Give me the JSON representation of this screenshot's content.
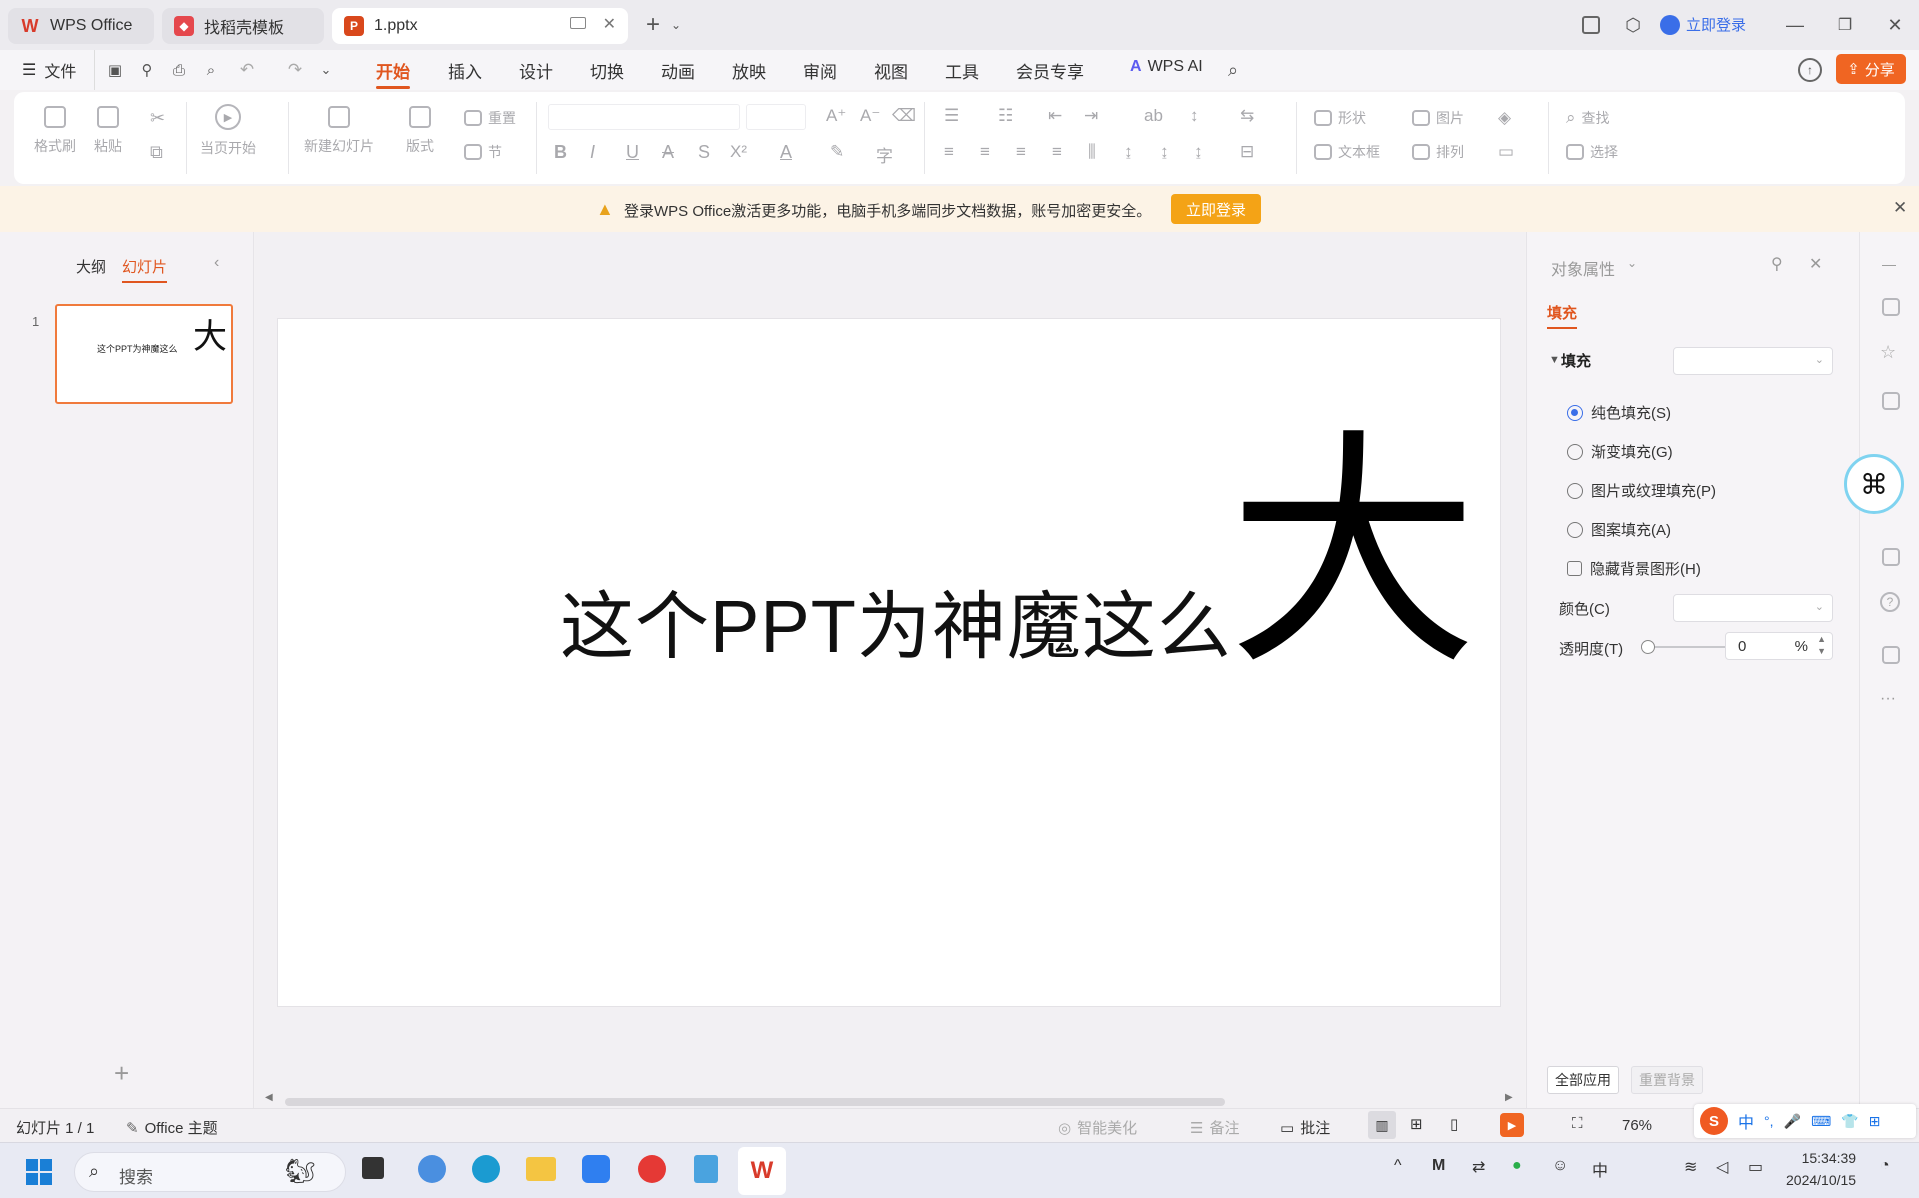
{
  "tabs": [
    {
      "label": "WPS Office",
      "icon": "wps-logo-icon"
    },
    {
      "label": "找稻壳模板",
      "icon": "docer-icon"
    },
    {
      "label": "1.pptx",
      "icon": "ppt-file-icon"
    }
  ],
  "titlebar": {
    "login_label": "立即登录"
  },
  "menu": {
    "file_label": "文件",
    "items": [
      "开始",
      "插入",
      "设计",
      "切换",
      "动画",
      "放映",
      "审阅",
      "视图",
      "工具",
      "会员专享"
    ],
    "active": "开始",
    "ai_label": "WPS AI",
    "share_label": "分享"
  },
  "ribbon": {
    "format_painter": "格式刷",
    "paste": "粘贴",
    "from_current": "当页开始",
    "new_slide": "新建幻灯片",
    "layout": "版式",
    "reset": "重置",
    "section": "节",
    "shape": "形状",
    "picture": "图片",
    "textbox": "文本框",
    "arrange": "排列",
    "find": "查找",
    "select": "选择"
  },
  "banner": {
    "message": "登录WPS Office激活更多功能，电脑手机多端同步文档数据，账号加密更安全。",
    "button": "立即登录"
  },
  "leftpanel": {
    "tab_outline": "大纲",
    "tab_slides": "幻灯片",
    "slide_number": "1",
    "thumb_text": "这个PPT为神魔这么",
    "thumb_big": "大"
  },
  "slide": {
    "text": "这个PPT为神魔这么",
    "big_char": "大"
  },
  "rightpanel": {
    "title": "对象属性",
    "tab_fill": "填充",
    "section_fill": "填充",
    "options": [
      "纯色填充(S)",
      "渐变填充(G)",
      "图片或纹理填充(P)",
      "图案填充(A)"
    ],
    "hide_bg": "隐藏背景图形(H)",
    "color_label": "颜色(C)",
    "transparency_label": "透明度(T)",
    "transparency_value": "0",
    "transparency_unit": "%",
    "apply_all": "全部应用",
    "reset_bg": "重置背景"
  },
  "statusbar": {
    "slide_count": "幻灯片 1 / 1",
    "theme": "Office 主题",
    "smart_beautify": "智能美化",
    "notes": "备注",
    "comments": "批注",
    "zoom": "76%"
  },
  "taskbar": {
    "search_placeholder": "搜索",
    "time": "15:34:39",
    "date": "2024/10/15",
    "ime": "中"
  }
}
